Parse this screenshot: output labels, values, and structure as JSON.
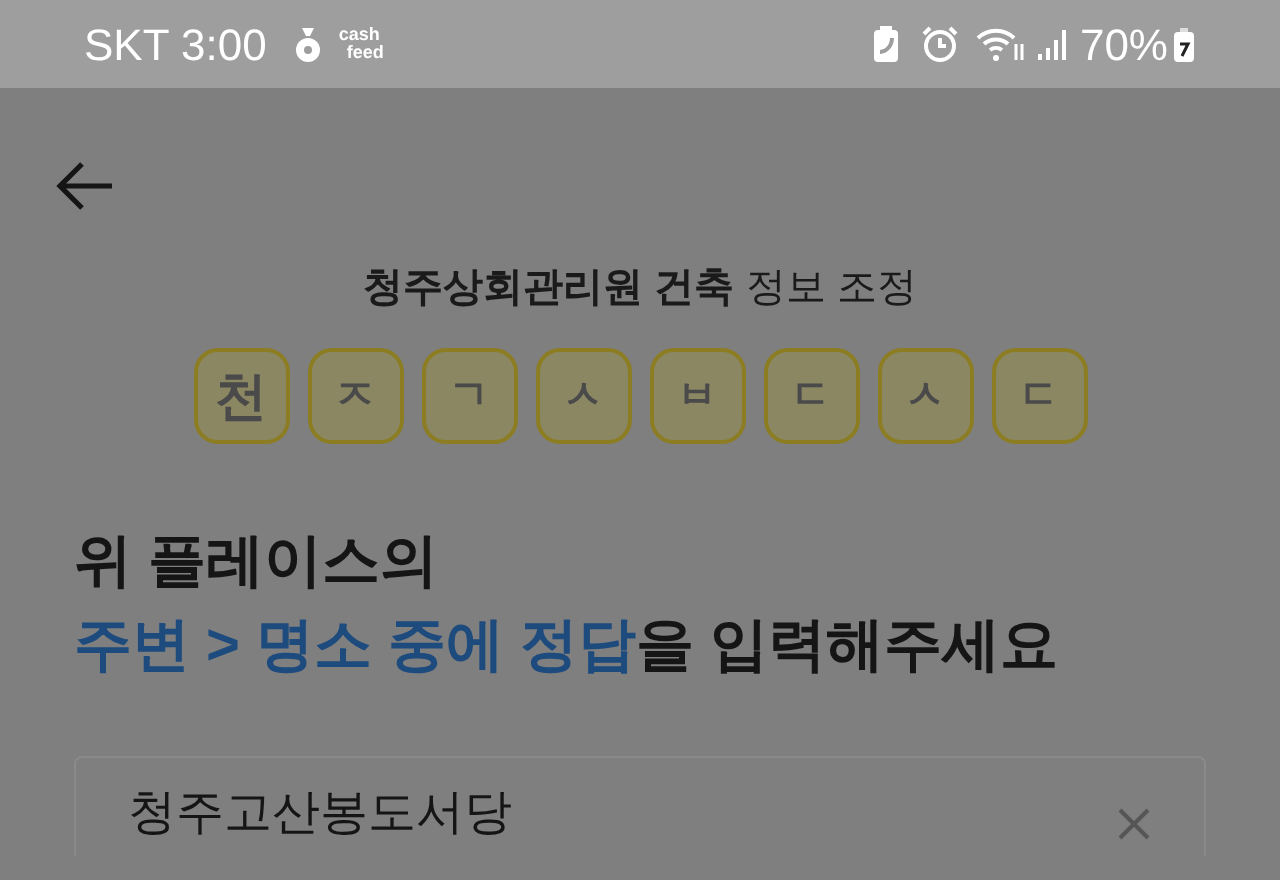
{
  "status_bar": {
    "carrier_time": "SKT 3:00",
    "app_logo": [
      "cash",
      "feed"
    ],
    "battery": "70%"
  },
  "place_title": {
    "bold": "청주상회관리원 건축",
    "regular": "정보 조정"
  },
  "hint_tiles": [
    "천",
    "ㅈ",
    "ㄱ",
    "ㅅ",
    "ㅂ",
    "ㄷ",
    "ㅅ",
    "ㄷ"
  ],
  "question": {
    "line_1": "위 플레이스의",
    "line_2": [
      {
        "text": "주변 > 명소 중에 정답",
        "highlight": true
      },
      {
        "text": "을 입력해주세요",
        "highlight": false
      }
    ]
  },
  "answer_field": {
    "value": "청주고산봉도서당"
  }
}
